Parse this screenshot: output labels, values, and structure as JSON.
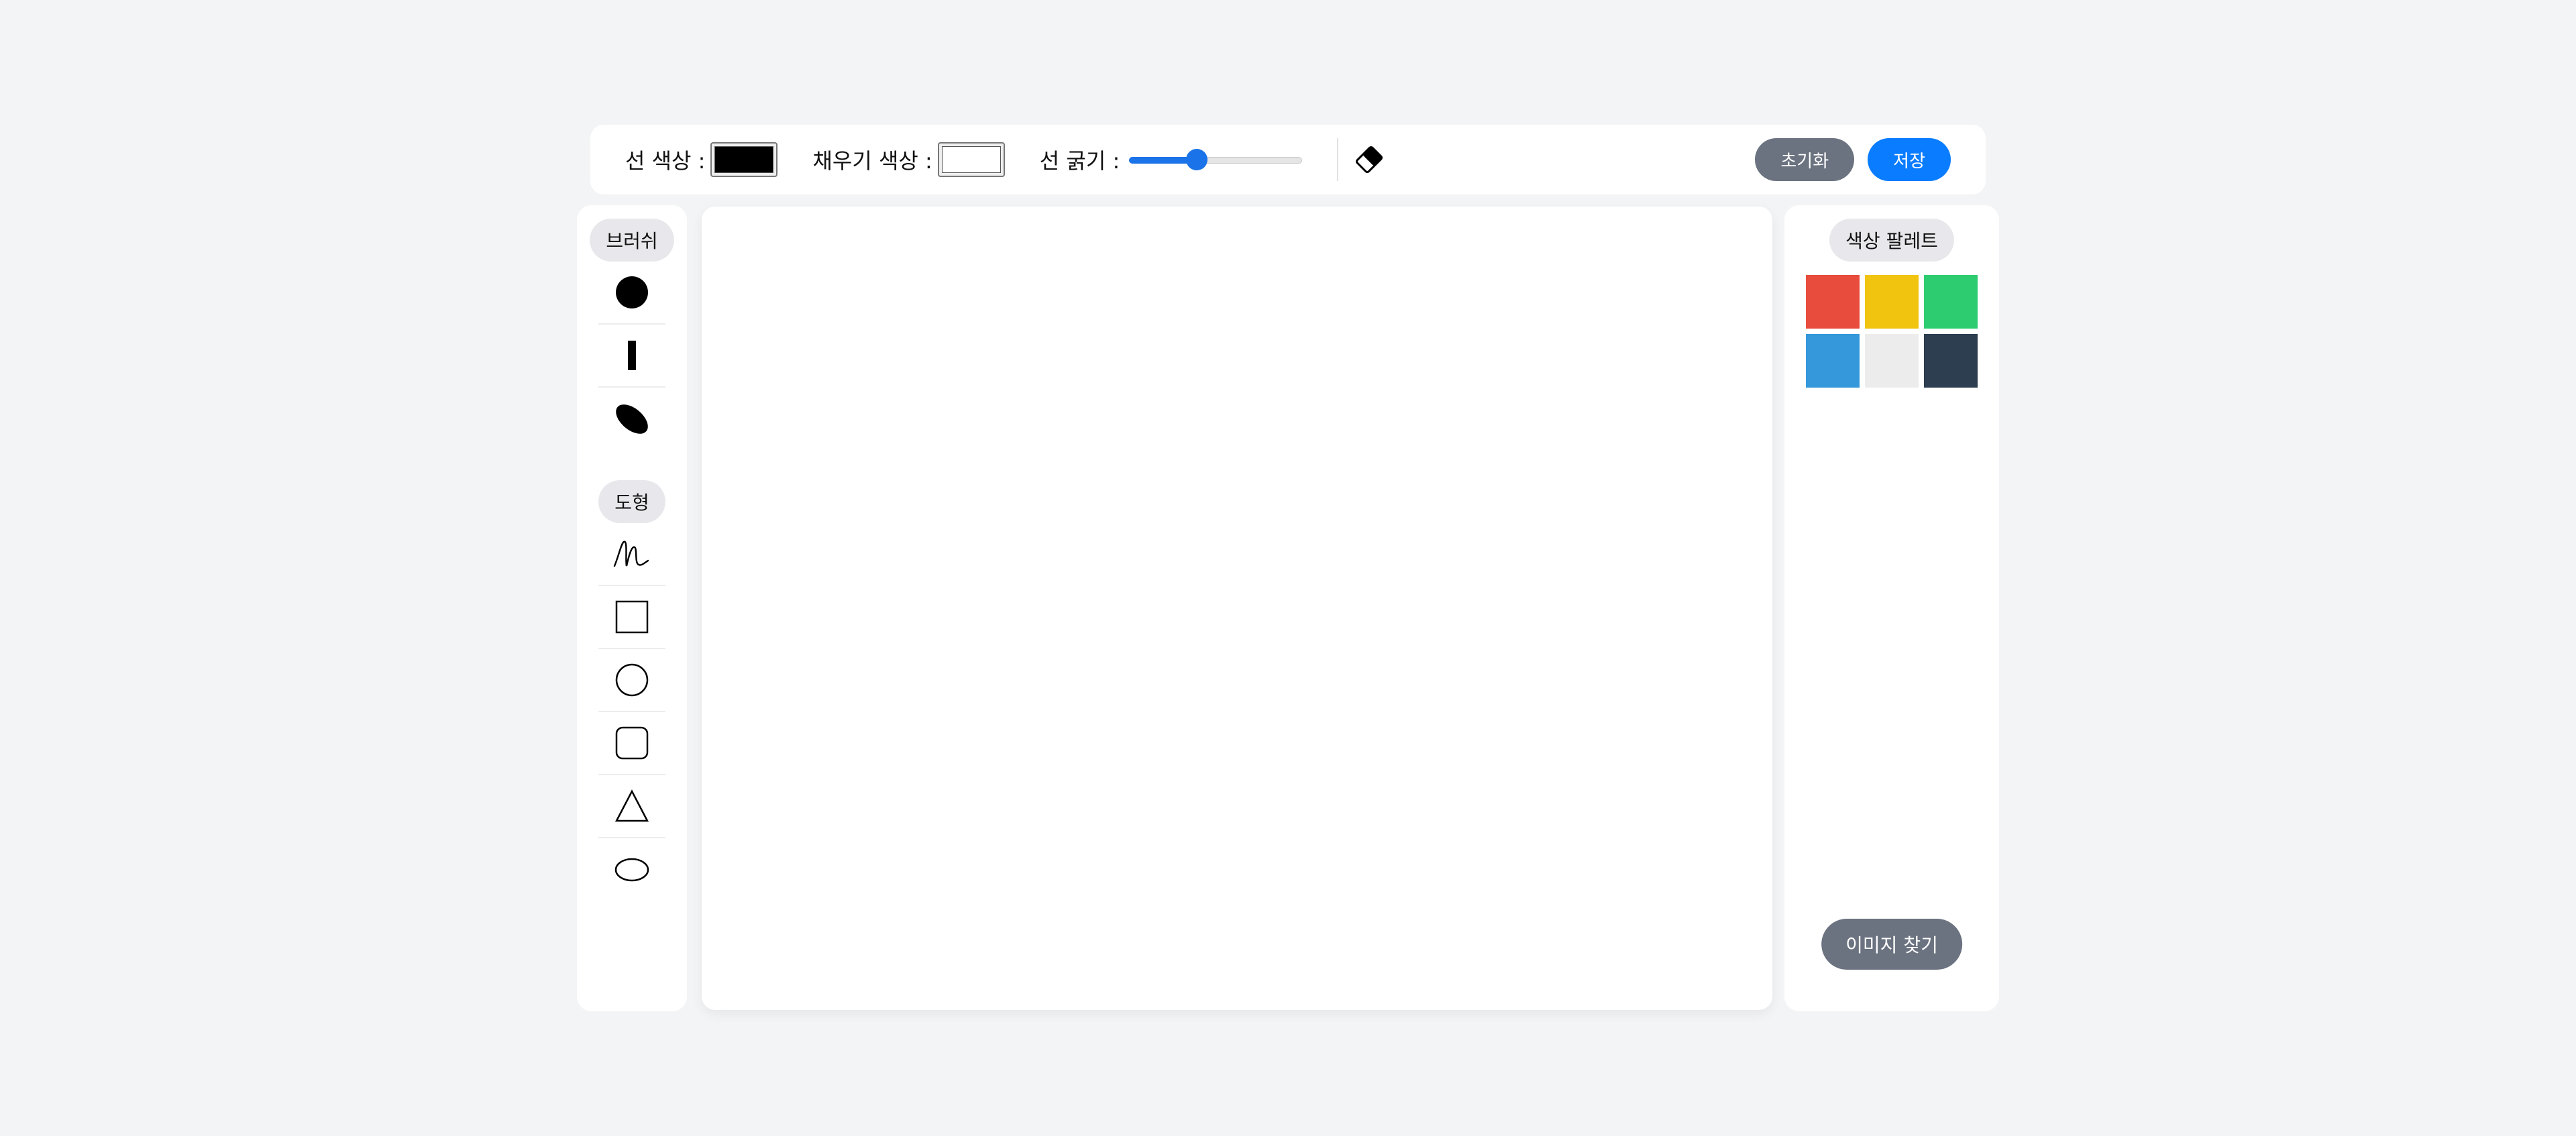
{
  "toolbar": {
    "stroke_color_label": "선 색상 :",
    "stroke_color_value": "#000000",
    "fill_color_label": "채우기 색상 :",
    "fill_color_value": "#ffffff",
    "line_width_label": "선 굵기 :",
    "line_width_fraction": 0.39,
    "eraser_icon": "eraser-icon",
    "reset_label": "초기화",
    "save_label": "저장"
  },
  "left_panel": {
    "brush_header": "브러쉬",
    "brushes": [
      {
        "icon": "round-brush-icon"
      },
      {
        "icon": "flat-brush-icon"
      },
      {
        "icon": "calligraphy-brush-icon"
      }
    ],
    "shape_header": "도형",
    "shapes": [
      {
        "icon": "freehand-icon"
      },
      {
        "icon": "rectangle-icon"
      },
      {
        "icon": "circle-icon"
      },
      {
        "icon": "rounded-rectangle-icon"
      },
      {
        "icon": "triangle-icon"
      },
      {
        "icon": "ellipse-icon"
      }
    ]
  },
  "right_panel": {
    "palette_header": "색상 팔레트",
    "palette_colors": [
      "#e74c3c",
      "#f1c40f",
      "#2ecc71",
      "#3498db",
      "#ececec",
      "#2c3e50"
    ],
    "find_image_label": "이미지 찾기"
  },
  "colors": {
    "accent": "#0a7cff",
    "secondary_button": "#6b7280",
    "background": "#f3f4f6"
  }
}
